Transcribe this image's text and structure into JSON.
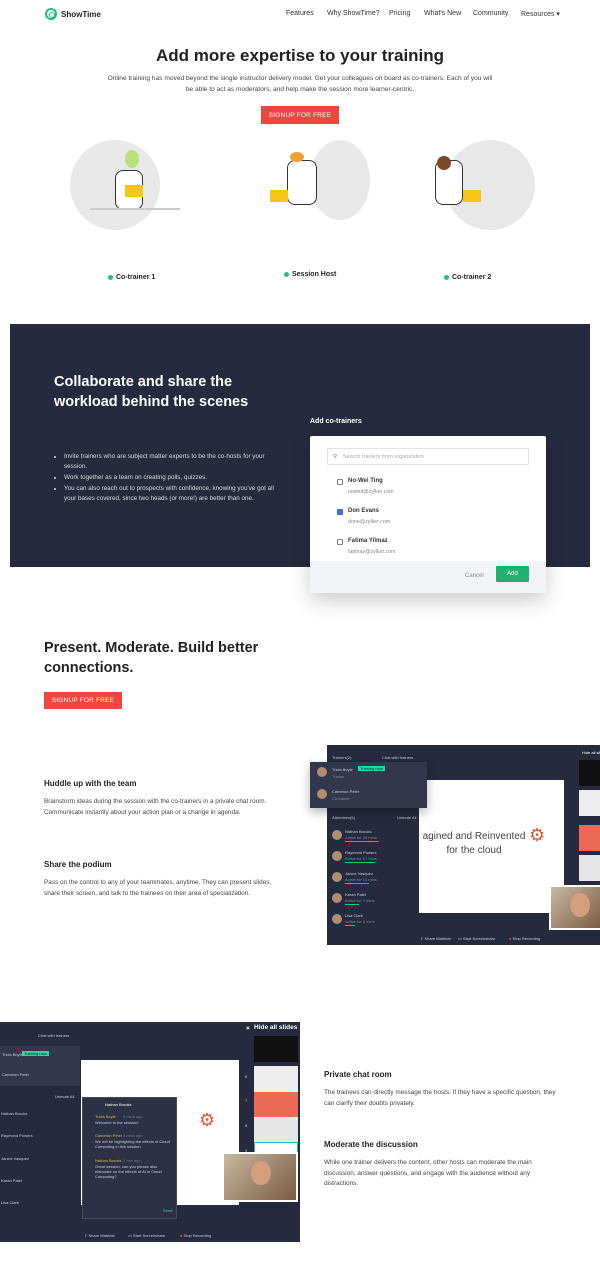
{
  "nav": {
    "brand": "ShowTime",
    "links": [
      "Features",
      "Why ShowTime?",
      "Pricing",
      "What's New",
      "Community",
      "Resources"
    ]
  },
  "hero": {
    "title": "Add more expertise to your training",
    "lead": "Online training has moved beyond the single instructor delivery model. Get your colleagues on board as co-trainers. Each of you will be able to act as moderators, and help make the session more learner-centric.",
    "cta": "SIGNUP FOR FREE",
    "roles": [
      "Co-trainer 1",
      "Session Host",
      "Co-trainer 2"
    ]
  },
  "collab": {
    "title": "Collaborate and share the workload behind the scenes",
    "bullets": [
      "Invite trainers who are subject matter experts to be the co-hosts for your session.",
      "Work together as a team on creating polls, quizzes.",
      "You can also reach out to prospects with confidence, knowing you've got all your bases covered, since two heads (or more!) are better than one."
    ],
    "modal": {
      "title": "Add co-trainers",
      "search_placeholder": "Search trainers from organization",
      "people": [
        {
          "name": "No-Wei Ting",
          "email": "noweit@zylker.com",
          "checked": false
        },
        {
          "name": "Don Evans",
          "email": "done@zylker.com",
          "checked": true
        },
        {
          "name": "Fatima Yilmaz",
          "email": "fatimay@zylker.com",
          "checked": false
        }
      ],
      "cancel": "Cancel",
      "add": "Add"
    }
  },
  "present": {
    "title": "Present. Moderate. Build better connections.",
    "cta": "SIGNUP FOR FREE"
  },
  "features": [
    {
      "title": "Huddle up with the team",
      "text": "Brainstorm ideas during the session with the co-trainers in a private chat room. Communicate instantly about your action plan or a change in agenda."
    },
    {
      "title": "Share the podium",
      "text": "Pass on the control to any of your teammates, anytime. They can present slides, share their screen, and talk to the trainees on their area of specialization."
    },
    {
      "title": "Private chat room",
      "text": "The trainees can directly message the hosts. If they have a specific question, they can clarify their doubts privately."
    },
    {
      "title": "Moderate the discussion",
      "text": "While one trainer delivers the content, other hosts can moderate the main discussion, answer questions, and engage with the audience without any distractions."
    }
  ],
  "app": {
    "trainers_label": "Trainers(2)",
    "chat_trainers": "Chat with trainers",
    "trainers": [
      {
        "name": "Tricia Boyle",
        "role": "Trainer",
        "badge": "Training now"
      },
      {
        "name": "Cameron Peter",
        "role": "Co-trainer"
      }
    ],
    "attendees_label": "Attendees(5)",
    "unmute_all": "Unmute All",
    "attendees": [
      {
        "name": "Nathan Brooks",
        "status": "Active for 20 mins"
      },
      {
        "name": "Raymond Powers",
        "status": "Active for 17 mins"
      },
      {
        "name": "Janice Vasquez",
        "status": "Active for 14 mins"
      },
      {
        "name": "Karan Patel",
        "status": "Active for 7 mins"
      },
      {
        "name": "Lisa Clark",
        "status": "Active for 5 mins"
      }
    ],
    "slide_text": "agined and Reinvented for the cloud",
    "hide_slides": "Hide all slides",
    "slide_nums": [
      "6",
      "7",
      "8",
      "9"
    ],
    "controls": [
      "Share Material",
      "Start Screenshare",
      "Stop Recording"
    ],
    "chat": {
      "header": "Nathan Brooks",
      "send": "Send",
      "messages": [
        {
          "name": "Tricia Boyle",
          "time": "3 mins ago",
          "text": "Welcome to the session!"
        },
        {
          "name": "Cameron Peter",
          "time": "3 mins ago",
          "text": "We will be highlighting the effects of Cloud Computing in this session."
        },
        {
          "name": "Nathan Brooks",
          "time": "1 min ago",
          "text": "Great session, can you please also elaborate on the effects of AI in Cloud Computing?"
        }
      ]
    }
  }
}
